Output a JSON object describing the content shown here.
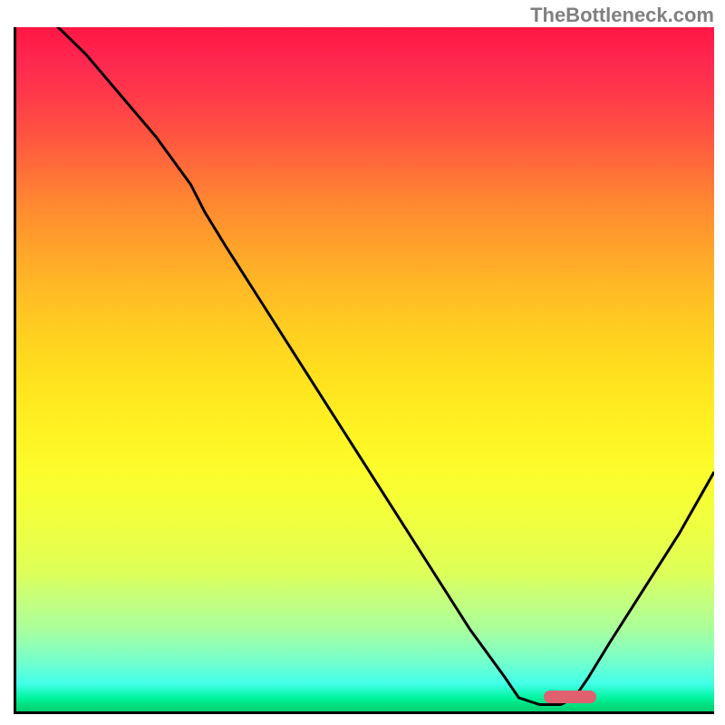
{
  "watermark": "TheBottleneck.com",
  "chart_data": {
    "type": "line",
    "title": "",
    "xlabel": "",
    "ylabel": "",
    "xlim": [
      0,
      100
    ],
    "ylim": [
      0,
      100
    ],
    "x": [
      0,
      5,
      10,
      15,
      20,
      25,
      27,
      30,
      35,
      40,
      45,
      50,
      55,
      60,
      65,
      70,
      72,
      75,
      78,
      80,
      82,
      85,
      90,
      95,
      100
    ],
    "values": [
      104,
      101,
      96,
      90,
      84,
      77,
      73,
      68,
      60,
      52,
      44,
      36,
      28,
      20,
      12,
      5,
      2,
      1,
      1,
      2,
      5,
      10,
      18,
      26,
      35
    ],
    "marker_x_range": [
      75,
      83
    ],
    "marker_y": 1,
    "note": "V-shaped bottleneck curve on red-to-green gradient background; minimum (optimal match) occurs around x≈76–80 at the green region; curve rises steeply to the left (binding bottleneck) and moderately to the right."
  },
  "colors": {
    "curve": "#000000",
    "marker": "#e06070",
    "border": "#000000",
    "gradient_top": "#ff1744",
    "gradient_bottom": "#00d070"
  }
}
